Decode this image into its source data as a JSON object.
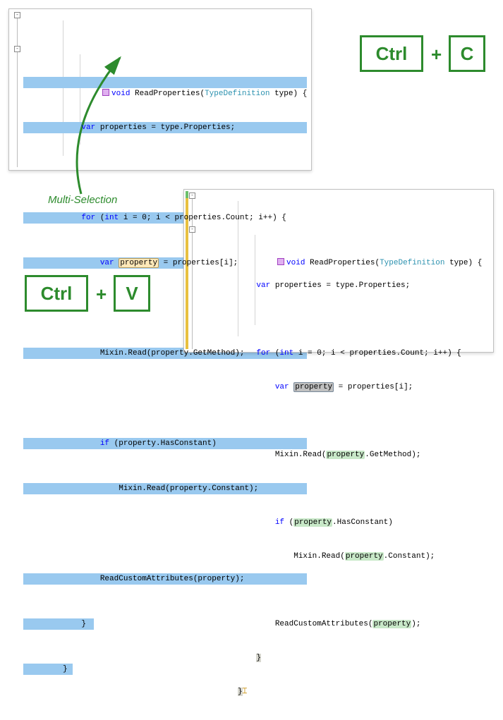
{
  "keys": {
    "ctrl1": "Ctrl",
    "plus1": "+",
    "c": "C",
    "ctrl2": "Ctrl",
    "plus2": "+",
    "v": "V"
  },
  "annotation": "Multi-Selection",
  "colors": {
    "accent": "#2d8b2d",
    "selection": "#99c9ef",
    "change_green": "#6cc06c",
    "change_yellow": "#e8c040"
  },
  "top_code": {
    "line1": {
      "pre": "",
      "icon": "method-icon",
      "kw": "void",
      "space": " ",
      "name": "ReadProperties(",
      "type": "TypeDefinition",
      "rest": " type) {"
    },
    "line2": {
      "indent": "    ",
      "kw": "var",
      "rest": " properties = type.Properties;"
    },
    "line3": "",
    "line4": {
      "indent": "    ",
      "kw1": "for",
      "paren": " (",
      "kw2": "int",
      "rest": " i = 0; i < properties.Count; i++) {"
    },
    "line5": {
      "indent": "        ",
      "kw": "var",
      "space": " ",
      "hl": "property",
      "rest": " = properties[i];"
    },
    "line6": "",
    "line7": {
      "indent": "        ",
      "txt": "Mixin.Read(property.GetMethod);"
    },
    "line8": "",
    "line9": {
      "indent": "        ",
      "kw": "if",
      "rest": " (property.HasConstant)"
    },
    "line10": {
      "indent": "            ",
      "txt": "Mixin.Read(property.Constant);"
    },
    "line11": "",
    "line12": {
      "indent": "        ",
      "txt": "ReadCustomAttributes(property);"
    },
    "line13": {
      "indent": "    ",
      "txt": "}"
    },
    "line14": {
      "indent": "",
      "txt": "}"
    }
  },
  "bottom_code": {
    "line1": {
      "icon": "method-icon",
      "kw": "void",
      "space": " ",
      "name": "ReadProperties(",
      "type": "TypeDefinition",
      "rest": " type) {"
    },
    "line2": {
      "indent": "    ",
      "kw": "var",
      "rest": " properties = type.Properties;"
    },
    "line3": "",
    "line4": {
      "indent": "    ",
      "kw1": "for",
      "paren": " (",
      "kw2": "int",
      "rest": " i = 0; i < properties.Count; i++) {"
    },
    "line5": {
      "indent": "        ",
      "kw": "var",
      "space": " ",
      "hl": "property",
      "rest": " = properties[i];"
    },
    "line6": "",
    "line7": {
      "indent": "        ",
      "pre": "Mixin.Read(",
      "occ": "property",
      "post": ".GetMethod);"
    },
    "line8": "",
    "line9": {
      "indent": "        ",
      "kw": "if",
      "paren": " (",
      "occ": "property",
      "post": ".HasConstant)"
    },
    "line10": {
      "indent": "            ",
      "pre": "Mixin.Read(",
      "occ": "property",
      "post": ".Constant);"
    },
    "line11": "",
    "line12": {
      "indent": "        ",
      "pre": "ReadCustomAttributes(",
      "occ": "property",
      "post": ");"
    },
    "line13": {
      "indent": "    ",
      "txt": "}"
    },
    "line14": {
      "indent": "",
      "txt": "}"
    }
  }
}
